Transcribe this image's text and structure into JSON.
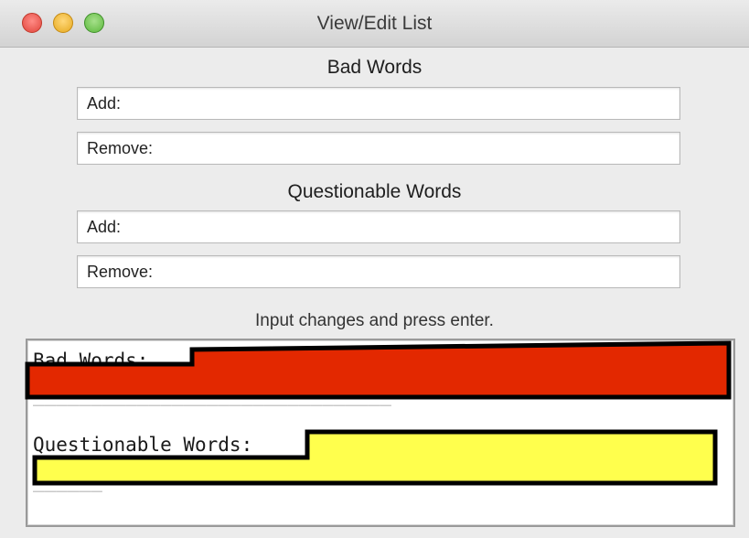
{
  "window": {
    "title": "View/Edit List"
  },
  "bad_words": {
    "heading": "Bad Words",
    "add_label": "Add:",
    "remove_label": "Remove:"
  },
  "questionable_words": {
    "heading": "Questionable Words",
    "add_label": "Add:",
    "remove_label": "Remove:"
  },
  "hint": "Input changes and press enter.",
  "output": {
    "bad_words_label": "Bad Words:",
    "questionable_words_label": "Questionable Words:"
  },
  "colors": {
    "bad_redaction": "#e32800",
    "questionable_redaction": "#ffff4d",
    "redaction_outline": "#000000"
  },
  "icons": {
    "close": "close-light-icon",
    "minimize": "minimize-light-icon",
    "maximize": "maximize-light-icon"
  }
}
